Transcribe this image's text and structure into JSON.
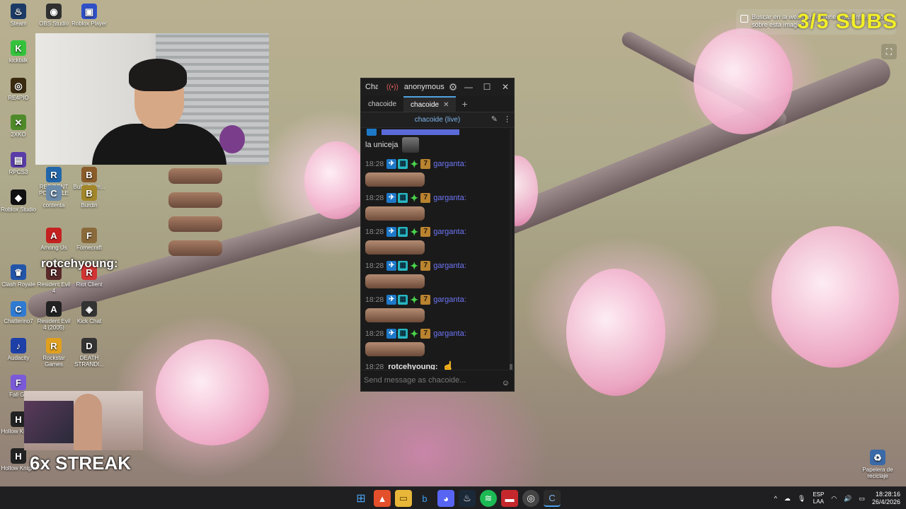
{
  "desktop": {
    "icons": [
      {
        "label": "Steam",
        "glyph": "♨",
        "color": "#1b3b66"
      },
      {
        "label": "OBS Studio",
        "glyph": "◉",
        "color": "#303030"
      },
      {
        "label": "Roblox Player",
        "glyph": "▣",
        "color": "#3050c8"
      },
      {
        "label": "kicktalk",
        "glyph": "K",
        "color": "#34c23c"
      },
      {
        "label": "RE4PIO",
        "glyph": "◎",
        "color": "#3a2a10"
      },
      {
        "label": "2XKO",
        "glyph": "✕",
        "color": "#4e8a2a"
      },
      {
        "label": "RPCS3",
        "glyph": "▤",
        "color": "#5a3ca8"
      },
      {
        "label": "Roblox Studio",
        "glyph": "◆",
        "color": "#111"
      },
      {
        "label": "RESIDENT PORTABLE",
        "glyph": "R",
        "color": "#2266aa"
      },
      {
        "label": "Bully Onlin...",
        "glyph": "B",
        "color": "#8a5c2a"
      },
      {
        "label": "contenta",
        "glyph": "C",
        "color": "#6a8aa8"
      },
      {
        "label": "Burdin",
        "glyph": "B",
        "color": "#a2862a"
      },
      {
        "label": "Among Us",
        "glyph": "A",
        "color": "#c52121"
      },
      {
        "label": "Fomecraft",
        "glyph": "F",
        "color": "#8a6a3a"
      },
      {
        "label": "Clash Royale",
        "glyph": "♛",
        "color": "#2255aa"
      },
      {
        "label": "Resident Evil 4",
        "glyph": "R",
        "color": "#5a2a2a"
      },
      {
        "label": "Riot Client",
        "glyph": "R",
        "color": "#d23434"
      },
      {
        "label": "Chatterino7",
        "glyph": "C",
        "color": "#2f7bd3"
      },
      {
        "label": "Resident Evil 4 (2005)",
        "glyph": "A",
        "color": "#222"
      },
      {
        "label": "Kick Chat",
        "glyph": "◈",
        "color": "#333"
      },
      {
        "label": "Audacity",
        "glyph": "♪",
        "color": "#1d3fa8"
      },
      {
        "label": "Rockstar Games",
        "glyph": "R",
        "color": "#e0a020"
      },
      {
        "label": "DEATH STRANDI...",
        "glyph": "D",
        "color": "#333"
      },
      {
        "label": "Fall Gu",
        "glyph": "F",
        "color": "#7a5ad8"
      },
      {
        "label": "Hollow Knight",
        "glyph": "H",
        "color": "#222"
      },
      {
        "label": "Hollow Knight",
        "glyph": "H",
        "color": "#222"
      },
      {
        "label": "Papelera de reciclaje",
        "glyph": "♻",
        "color": "#3a6aa8"
      }
    ]
  },
  "overlay": {
    "subs_text": "3/5  SUBS",
    "lens_tip": "Buscar en la web para obtener más información sobre esta imagen",
    "last_user": "rotcehyoung:",
    "streak_text": "6x STREAK"
  },
  "chat_window": {
    "app_name": "Chatterino",
    "user": "anonymous",
    "tabs": [
      {
        "label": "chacoide",
        "active": false
      },
      {
        "label": "chacoide",
        "active": true
      }
    ],
    "split_title": "chacoide (live)",
    "partial_text": "la uniceja",
    "messages": [
      {
        "time": "18:28",
        "user": "garganta:"
      },
      {
        "time": "18:28",
        "user": "garganta:"
      },
      {
        "time": "18:28",
        "user": "garganta:"
      },
      {
        "time": "18:28",
        "user": "garganta:"
      },
      {
        "time": "18:28",
        "user": "garganta:"
      },
      {
        "time": "18:28",
        "user": "garganta:"
      }
    ],
    "last_message": {
      "time": "18:28",
      "user": "rotcehyoung:"
    },
    "input_placeholder": "Send message as chacoide..."
  },
  "taskbar": {
    "apps": [
      "windows-start",
      "brave",
      "file-explorer",
      "bing",
      "discord",
      "steam",
      "spotify",
      "recorder",
      "chrome",
      "chatterino"
    ],
    "lang_line1": "ESP",
    "lang_line2": "LAA",
    "time": "18:28:16",
    "date": "26/4/2026"
  }
}
